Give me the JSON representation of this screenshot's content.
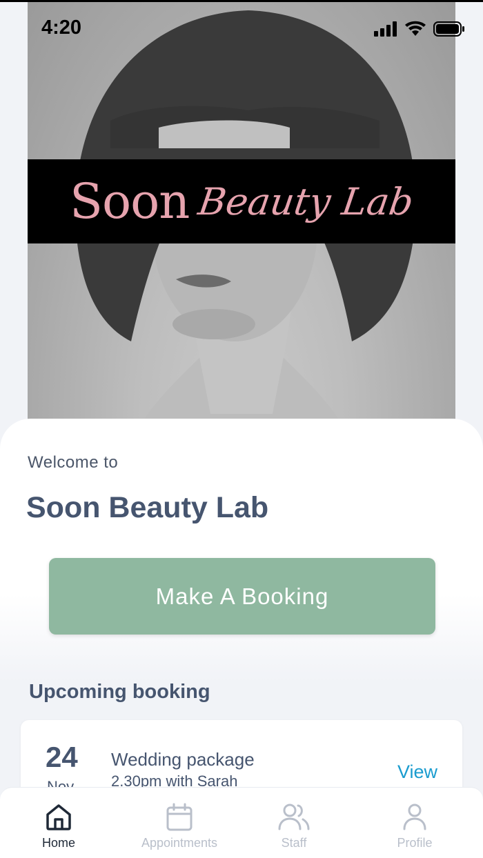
{
  "status_bar": {
    "time": "4:20"
  },
  "hero": {
    "logo_word": "Soon",
    "logo_script": "Beauty Lab",
    "colors": {
      "logo_pink": "#e6a3ae",
      "band": "#000000"
    }
  },
  "welcome": {
    "label": "Welcome to",
    "business_name": "Soon Beauty Lab"
  },
  "booking_button": {
    "label": "Make A Booking",
    "color": "#8fb8a0"
  },
  "upcoming": {
    "title": "Upcoming booking",
    "card": {
      "day": "24",
      "month": "Nov",
      "service": "Wedding package",
      "detail": "2.30pm with Sarah",
      "action": "View"
    }
  },
  "tab_bar": {
    "tabs": [
      {
        "label": "Home",
        "icon": "home-icon",
        "active": true
      },
      {
        "label": "Appointments",
        "icon": "calendar-icon",
        "active": false
      },
      {
        "label": "Staff",
        "icon": "users-icon",
        "active": false
      },
      {
        "label": "Profile",
        "icon": "user-icon",
        "active": false
      }
    ]
  },
  "colors": {
    "heading": "#46556f",
    "link": "#1a9ccf",
    "background": "#f1f3f7"
  }
}
